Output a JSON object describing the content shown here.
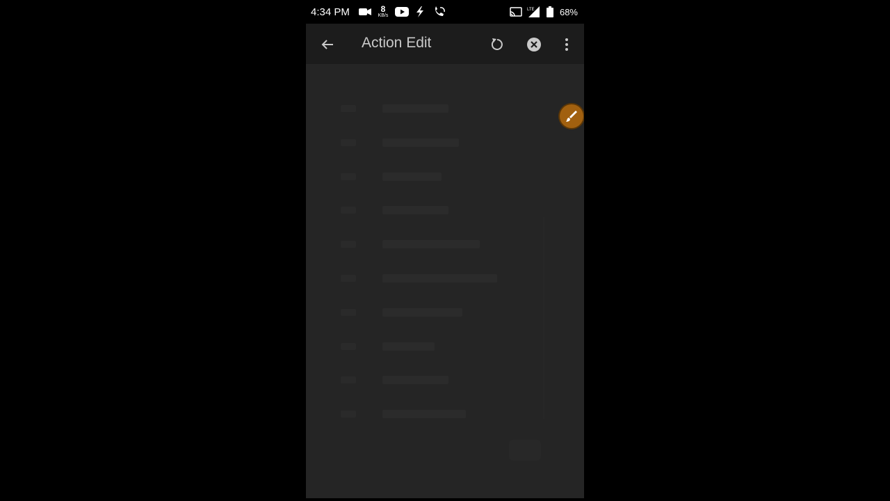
{
  "status_bar": {
    "time": "4:34 PM",
    "net_speed_value": "8",
    "net_speed_unit": "KB/s",
    "network_label": "LTE",
    "battery": "68%",
    "icons": [
      "video-camera-icon",
      "youtube-icon",
      "flash-icon",
      "phone-call-icon",
      "cast-icon",
      "signal-icon",
      "battery-icon"
    ]
  },
  "app_bar": {
    "title": "Action Edit",
    "icons": [
      "back-arrow-icon",
      "refresh-icon",
      "close-circle-icon",
      "more-vert-icon"
    ]
  },
  "floating": {
    "icon": "paint-brush-icon",
    "color": "#a1600f"
  },
  "colors": {
    "background": "#000000",
    "app_bar": "#1c1c1c",
    "content": "#252525",
    "title_text": "#c9c9c9"
  }
}
